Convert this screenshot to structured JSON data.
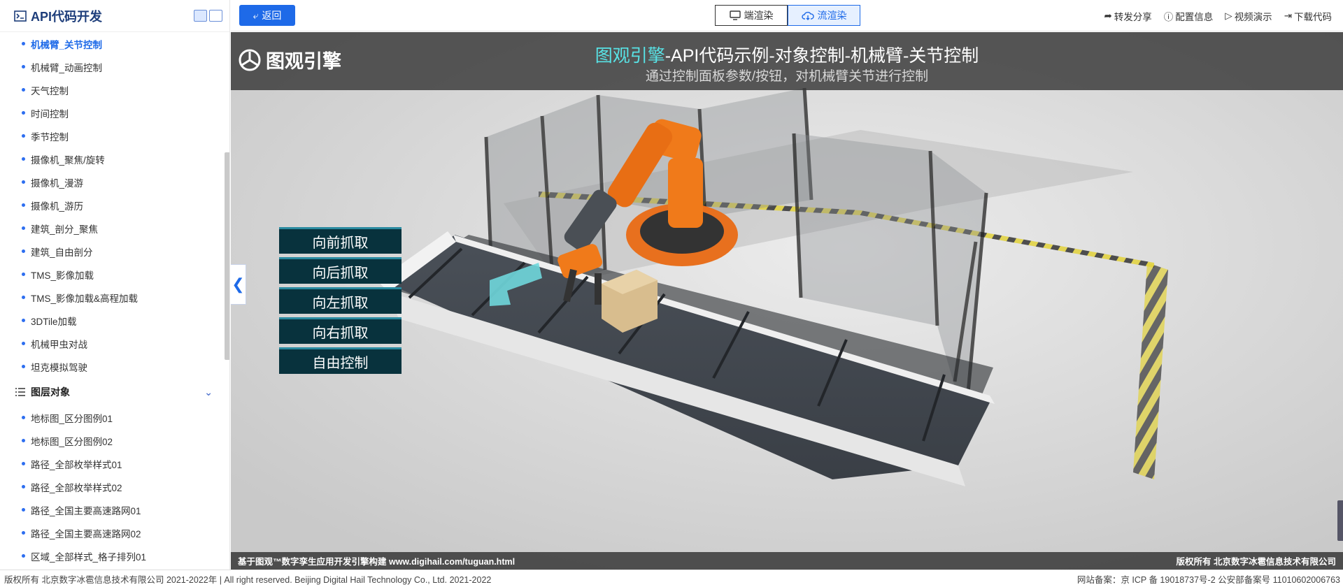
{
  "sidebar": {
    "title": "API代码开发",
    "items_top": [
      {
        "label": "机械臂_关节控制",
        "active": true
      },
      {
        "label": "机械臂_动画控制"
      },
      {
        "label": "天气控制"
      },
      {
        "label": "时间控制"
      },
      {
        "label": "季节控制"
      },
      {
        "label": "摄像机_聚焦/旋转"
      },
      {
        "label": "摄像机_漫游"
      },
      {
        "label": "摄像机_游历"
      },
      {
        "label": "建筑_剖分_聚焦"
      },
      {
        "label": "建筑_自由剖分"
      },
      {
        "label": "TMS_影像加载"
      },
      {
        "label": "TMS_影像加载&高程加载"
      },
      {
        "label": "3DTile加载"
      },
      {
        "label": "机械甲虫对战"
      },
      {
        "label": "坦克模拟驾驶"
      }
    ],
    "group_label": "图层对象",
    "items_bottom": [
      {
        "label": "地标图_区分图例01"
      },
      {
        "label": "地标图_区分图例02"
      },
      {
        "label": "路径_全部枚举样式01"
      },
      {
        "label": "路径_全部枚举样式02"
      },
      {
        "label": "路径_全国主要高速路网01"
      },
      {
        "label": "路径_全国主要高速路网02"
      },
      {
        "label": "区域_全部样式_格子排列01"
      }
    ]
  },
  "toolbar": {
    "back_label": "返回",
    "render_tabs": [
      "端渲染",
      "流渲染"
    ],
    "active_tab": "流渲染",
    "links": [
      {
        "label": "转发分享",
        "icon": "share-icon"
      },
      {
        "label": "配置信息",
        "icon": "info-icon"
      },
      {
        "label": "视频演示",
        "icon": "play-icon"
      },
      {
        "label": "下载代码",
        "icon": "download-icon"
      }
    ]
  },
  "viewport": {
    "logo_text": "图观引擎",
    "title_highlight": "图观引擎",
    "title_rest": "-API代码示例-对象控制-机械臂-关节控制",
    "subtitle": "通过控制面板参数/按钮，对机械臂关节进行控制",
    "controls": [
      "向前抓取",
      "向后抓取",
      "向左抓取",
      "向右抓取",
      "自由控制"
    ],
    "footer_left": "基于图观™数字孪生应用开发引擎构建 www.digihail.com/tuguan.html",
    "footer_right": "版权所有 北京数字冰雹信息技术有限公司"
  },
  "page_footer": {
    "left": "版权所有 北京数字冰雹信息技术有限公司 2021-2022年 | All right reserved. Beijing Digital Hail Technology Co., Ltd. 2021-2022",
    "right": "网站备案：京 ICP 备 19018737号-2 公安部备案号 11010602006763"
  },
  "colors": {
    "accent": "#1e6ae8",
    "title_highlight": "#58e3e6",
    "robot": "#f07a1a"
  }
}
